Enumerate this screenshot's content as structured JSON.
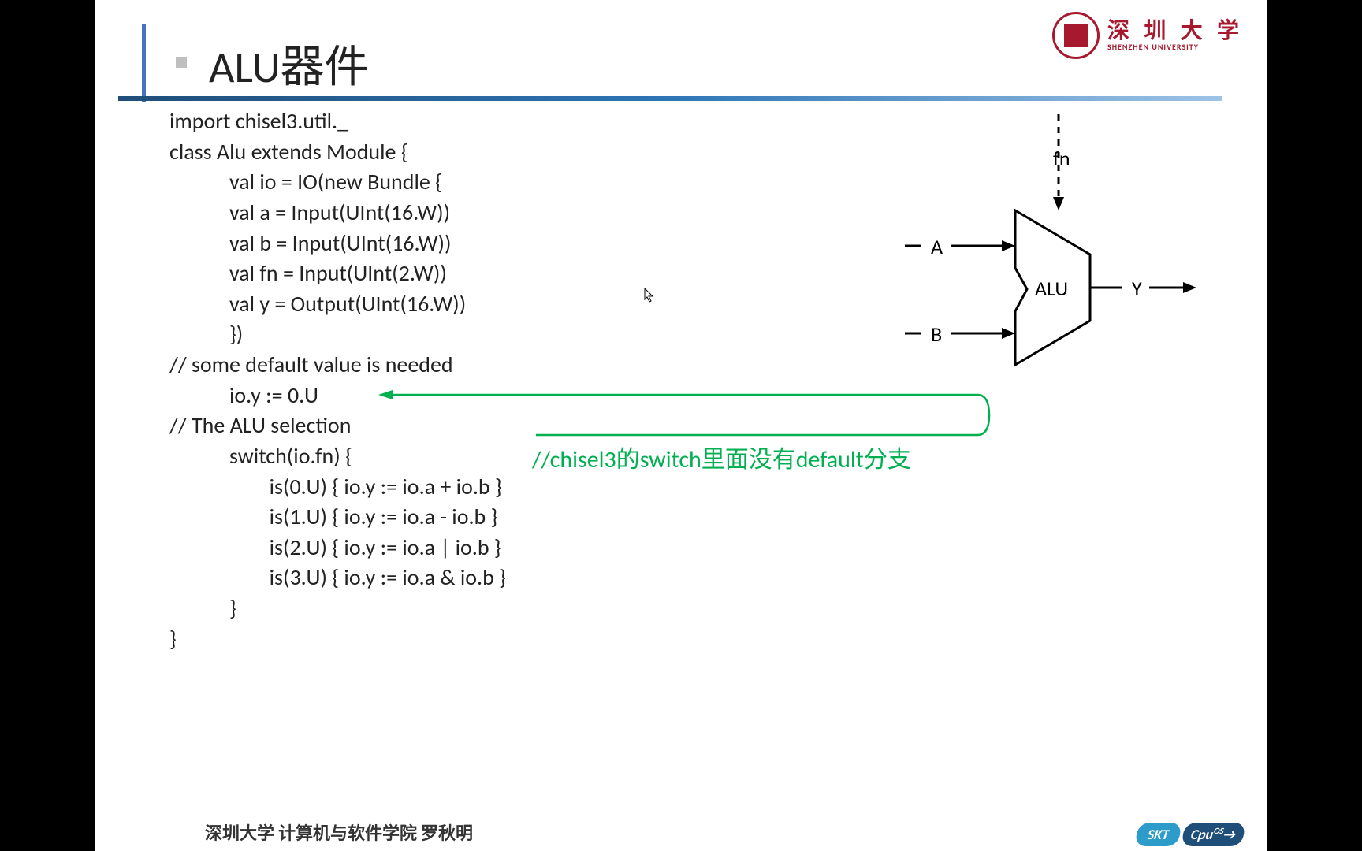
{
  "title": "ALU器件",
  "university": {
    "name_cn": "深 圳 大 学",
    "name_en": "SHENZHEN UNIVERSITY"
  },
  "code": {
    "line1": "import chisel3.util._",
    "line2": "class Alu extends Module {",
    "line3": "            val io = IO(new Bundle {",
    "line4": "            val a = Input(UInt(16.W))",
    "line5": "            val b = Input(UInt(16.W))",
    "line6": "            val fn = Input(UInt(2.W))",
    "line7": "            val y = Output(UInt(16.W))",
    "line8": "            })",
    "line9": "// some default value is needed",
    "line10": "            io.y := 0.U",
    "line11": "// The ALU selection",
    "line12": "            switch(io.fn) {",
    "line13": "                    is(0.U) { io.y := io.a + io.b }",
    "line14": "                    is(1.U) { io.y := io.a - io.b }",
    "line15": "                    is(2.U) { io.y := io.a | io.b }",
    "line16": "                    is(3.U) { io.y := io.a & io.b }",
    "line17": "            }",
    "line18": "}"
  },
  "annotation": "//chisel3的switch里面没有default分支",
  "diagram": {
    "label_fn": "fn",
    "label_a": "A",
    "label_b": "B",
    "label_y": "Y",
    "label_alu": "ALU"
  },
  "footer": {
    "text": "深圳大学   计算机与软件学院     罗秋明",
    "badge1": "SKT",
    "badge2": "Cpu"
  }
}
